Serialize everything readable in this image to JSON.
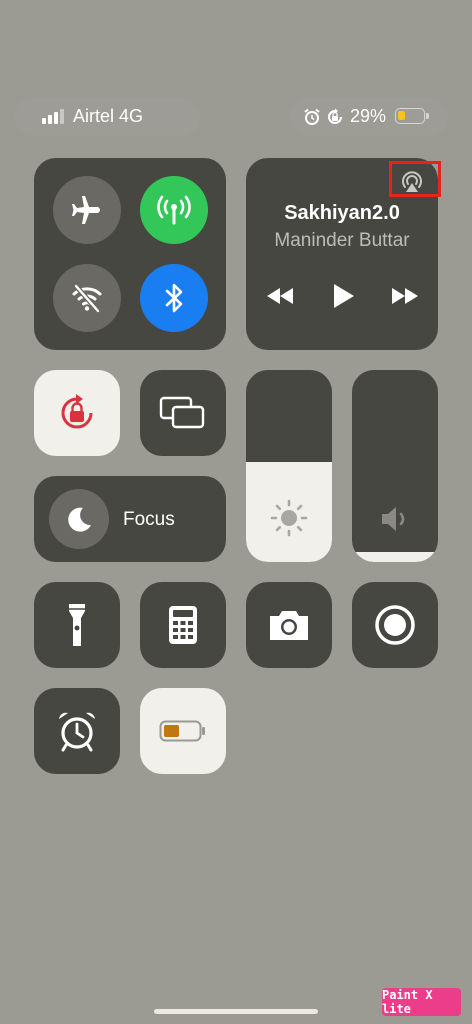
{
  "status": {
    "carrier": "Airtel 4G",
    "battery_percent": "29%",
    "battery_level": 0.29
  },
  "now_playing": {
    "song": "Sakhiyan2.0",
    "artist": "Maninder Buttar"
  },
  "focus": {
    "label": "Focus"
  },
  "sliders": {
    "brightness_level": 0.52,
    "volume_level": 0.05
  },
  "watermark": {
    "text": "Paint X lite"
  },
  "colors": {
    "background": "#9b9a93",
    "tile": "#474741",
    "green": "#33c759",
    "blue": "#1a7ef3",
    "lock_red": "#d9333f",
    "highlight_box": "#e8231a",
    "watermark_pink": "#ec3d8b"
  }
}
